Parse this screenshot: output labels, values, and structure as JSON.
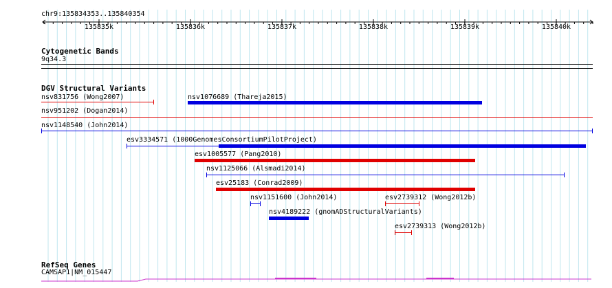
{
  "ruler": {
    "location": "chr9:135834353..135840354",
    "ticks": [
      "135835k",
      "135836k",
      "135837k",
      "135838k",
      "135839k",
      "135840k"
    ]
  },
  "tracks": {
    "cytoband": {
      "title": "Cytogenetic Bands",
      "band": "9q34.3"
    },
    "dgv": {
      "title": "DGV Structural Variants",
      "features": [
        {
          "label": "nsv831756 (Wong2007)",
          "color": "#e00000",
          "type": "line"
        },
        {
          "label": "nsv1076689 (Thareja2015)",
          "color": "#0000e0",
          "type": "thick"
        },
        {
          "label": "nsv951202 (Dogan2014)",
          "color": "#e00000",
          "type": "line"
        },
        {
          "label": "nsv1148540 (John2014)",
          "color": "#0000e0",
          "type": "line"
        },
        {
          "label": "esv3334571 (1000GenomesConsortiumPilotProject)",
          "color": "#0000e0",
          "type": "mixed"
        },
        {
          "label": "esv1005577 (Pang2010)",
          "color": "#e00000",
          "type": "thick"
        },
        {
          "label": "nsv1125066 (Alsmadi2014)",
          "color": "#0000e0",
          "type": "line"
        },
        {
          "label": "esv25183 (Conrad2009)",
          "color": "#e00000",
          "type": "thick"
        },
        {
          "label": "nsv1151600 (John2014)",
          "color": "#0000e0",
          "type": "line"
        },
        {
          "label": "esv2739312 (Wong2012b)",
          "color": "#e00000",
          "type": "line"
        },
        {
          "label": "nsv4189222 (gnomADStructuralVariants)",
          "color": "#0000e0",
          "type": "thick"
        },
        {
          "label": "esv2739313 (Wong2012b)",
          "color": "#e00000",
          "type": "line"
        }
      ]
    },
    "refseq": {
      "title": "RefSeq Genes",
      "gene": "CAMSAP1|NM_015447",
      "color": "#cc33cc"
    }
  }
}
